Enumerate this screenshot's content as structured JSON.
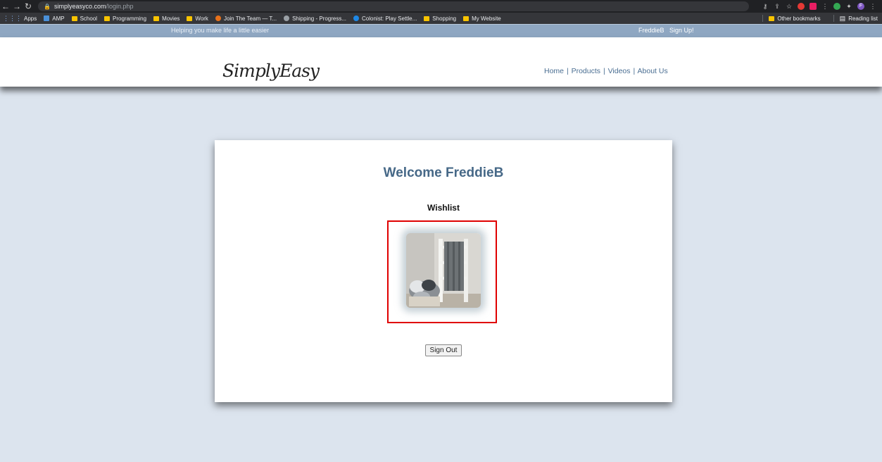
{
  "browser": {
    "url_domain": "simplyeasyco.com",
    "url_path": "/login.php",
    "avatar_letter": "F",
    "bookmarks": [
      {
        "label": "Apps",
        "kind": "grid"
      },
      {
        "label": "AMP",
        "kind": "icon",
        "color": "#4a90d9"
      },
      {
        "label": "School",
        "kind": "folder"
      },
      {
        "label": "Programming",
        "kind": "folder"
      },
      {
        "label": "Movies",
        "kind": "folder"
      },
      {
        "label": "Work",
        "kind": "folder"
      },
      {
        "label": "Join The Team — T...",
        "kind": "icon",
        "color": "#e8711a"
      },
      {
        "label": "Shipping - Progress...",
        "kind": "icon",
        "color": "#9aa0a6"
      },
      {
        "label": "Colonist: Play Settle...",
        "kind": "icon",
        "color": "#1e88e5"
      },
      {
        "label": "Shopping",
        "kind": "folder"
      },
      {
        "label": "My Website",
        "kind": "folder"
      }
    ],
    "other_bookmarks": "Other bookmarks",
    "reading_list": "Reading list"
  },
  "site": {
    "tagline": "Helping you make life a little easier",
    "username": "FreddieB",
    "signup": "Sign Up!",
    "logo": "SimplyEasy",
    "nav": [
      "Home",
      "Products",
      "Videos",
      "About Us"
    ],
    "welcome": "Welcome FreddieB",
    "wishlist_heading": "Wishlist",
    "signout_label": "Sign Out"
  },
  "colors": {
    "page_bg": "#dce4ee",
    "topbar_bg": "#8fa7c2",
    "accent": "#466887",
    "highlight": "#e00000"
  }
}
